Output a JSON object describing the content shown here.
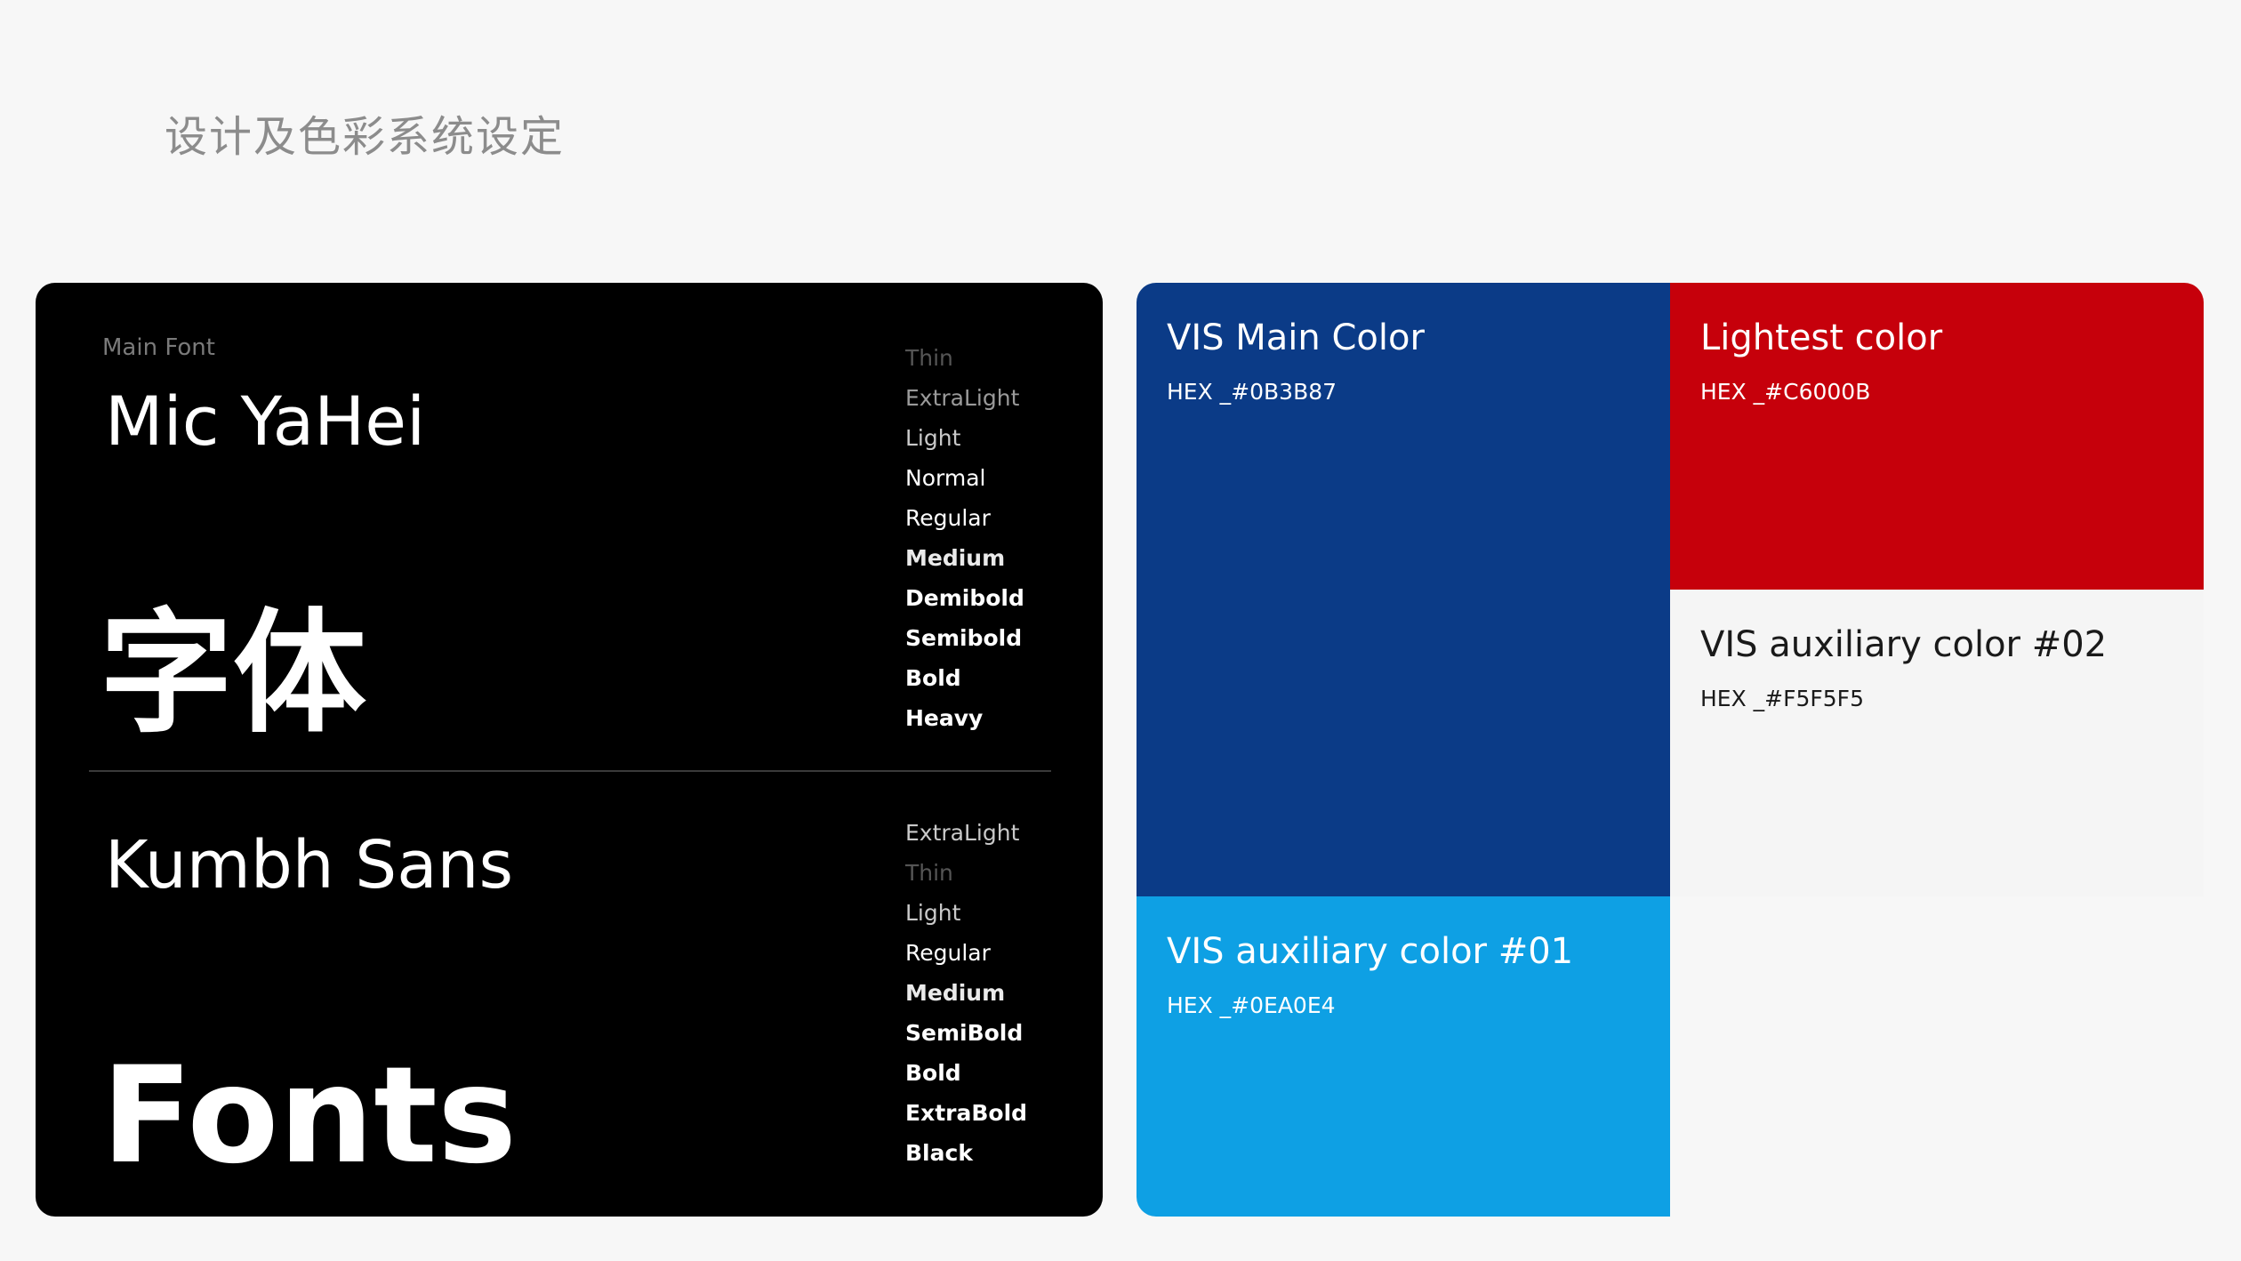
{
  "page": {
    "title": "设计及色彩系统设定"
  },
  "fonts": {
    "label": "Main Font",
    "primary": {
      "name": "Mic YaHei",
      "sample": "字体",
      "weights": [
        "Thin",
        "ExtraLight",
        "Light",
        "Normal",
        "Regular",
        "Medium",
        "Demibold",
        "Semibold",
        "Bold",
        "Heavy"
      ]
    },
    "secondary": {
      "name": "Kumbh Sans",
      "sample": "Fonts",
      "weights": [
        "ExtraLight",
        "Thin",
        "Light",
        "Regular",
        "Medium",
        "SemiBold",
        "Bold",
        "ExtraBold",
        "Black"
      ]
    }
  },
  "colors": {
    "main": {
      "name": "VIS Main Color",
      "hex_label": "HEX _#0B3B87",
      "hex": "#0B3B87"
    },
    "lightest": {
      "name": "Lightest color",
      "hex_label": "HEX _#C6000B",
      "hex": "#C6000B"
    },
    "aux2": {
      "name": "VIS auxiliary color #02",
      "hex_label": "HEX _#F5F5F5",
      "hex": "#F5F5F5"
    },
    "aux1": {
      "name": "VIS auxiliary color #01",
      "hex_label": "HEX _#0EA0E4",
      "hex": "#0EA0E4"
    }
  }
}
